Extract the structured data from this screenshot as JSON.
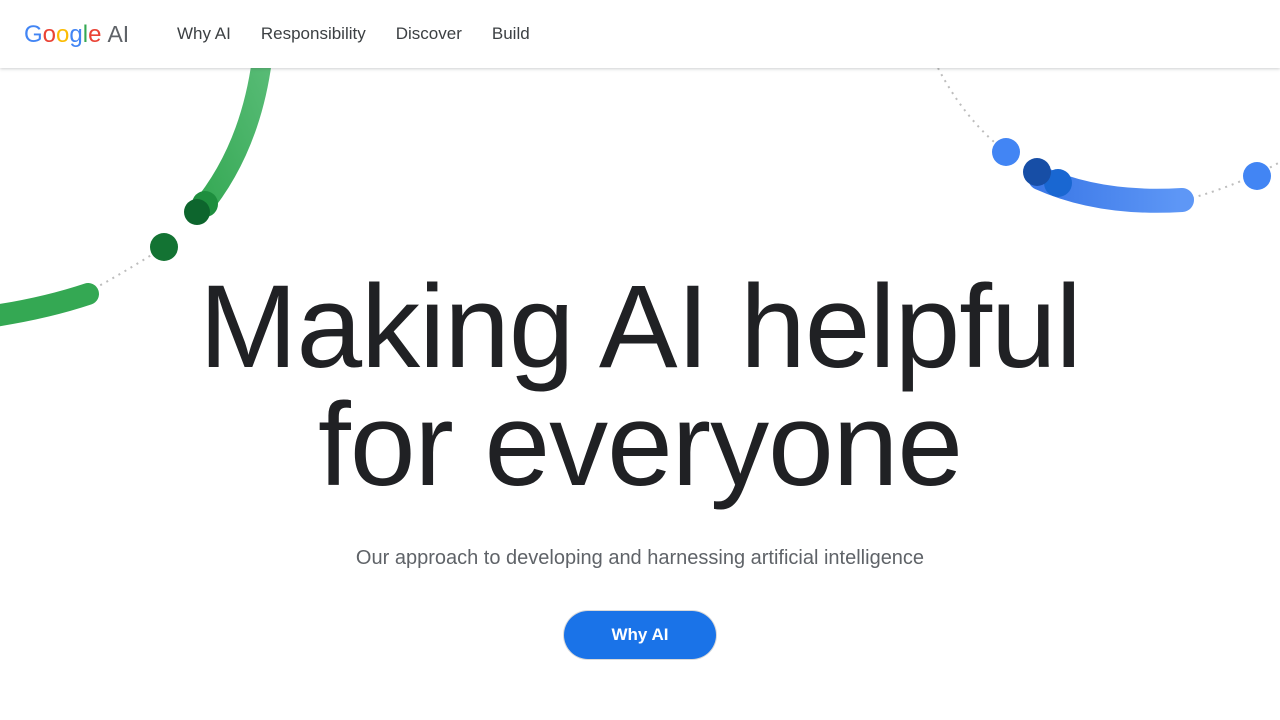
{
  "header": {
    "logo": {
      "google": [
        "G",
        "o",
        "o",
        "g",
        "l",
        "e"
      ],
      "suffix": "AI"
    },
    "nav": [
      {
        "label": "Why AI"
      },
      {
        "label": "Responsibility"
      },
      {
        "label": "Discover"
      },
      {
        "label": "Build"
      }
    ]
  },
  "hero": {
    "title_line1": "Making AI helpful",
    "title_line2": "for everyone",
    "subtitle": "Our approach to developing and harnessing artificial intelligence",
    "cta_label": "Why AI"
  },
  "colors": {
    "brand_blue": "#1a73e8",
    "green_arc": "#34A853",
    "dark_green": "#137333",
    "blue_arc": "#4285F4",
    "dark_blue": "#174ea6"
  }
}
